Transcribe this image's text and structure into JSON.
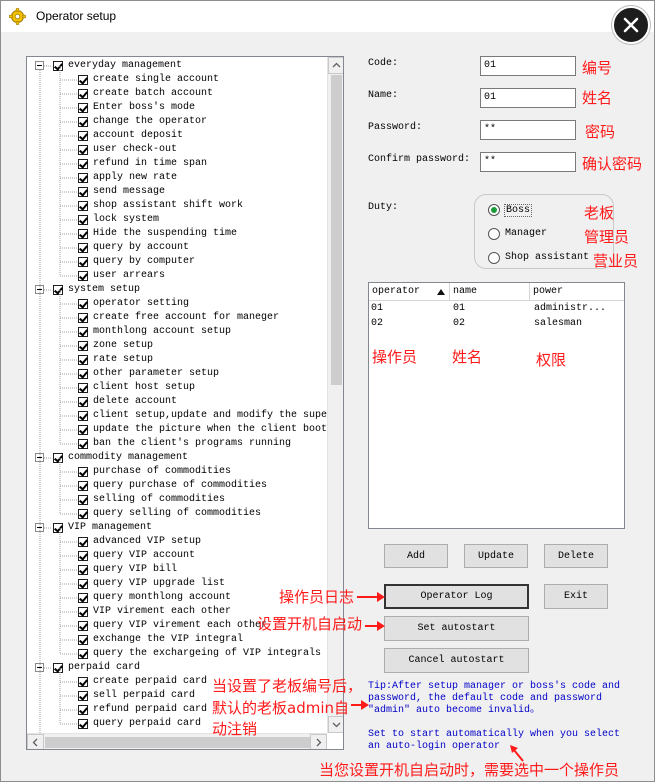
{
  "window": {
    "title": "Operator setup"
  },
  "tree": [
    {
      "label": "everyday management",
      "level": 0,
      "expander": true
    },
    {
      "label": "create single account",
      "level": 1
    },
    {
      "label": "create batch account",
      "level": 1
    },
    {
      "label": "Enter boss's mode",
      "level": 1
    },
    {
      "label": "change the operator",
      "level": 1
    },
    {
      "label": "account deposit",
      "level": 1
    },
    {
      "label": "user check-out",
      "level": 1
    },
    {
      "label": "refund in time span",
      "level": 1
    },
    {
      "label": "apply new rate",
      "level": 1
    },
    {
      "label": "send message",
      "level": 1
    },
    {
      "label": "shop assistant shift work",
      "level": 1
    },
    {
      "label": "lock system",
      "level": 1
    },
    {
      "label": "Hide the suspending time",
      "level": 1
    },
    {
      "label": " query by account",
      "level": 1
    },
    {
      "label": " query by computer",
      "level": 1
    },
    {
      "label": "user arrears",
      "level": 1
    },
    {
      "label": "system setup",
      "level": 0,
      "expander": true
    },
    {
      "label": "operator setting",
      "level": 1
    },
    {
      "label": "create free account for maneger",
      "level": 1
    },
    {
      "label": "monthlong account setup",
      "level": 1
    },
    {
      "label": "zone setup",
      "level": 1
    },
    {
      "label": "rate setup",
      "level": 1
    },
    {
      "label": "other parameter setup",
      "level": 1
    },
    {
      "label": "client host setup",
      "level": 1
    },
    {
      "label": "delete account",
      "level": 1
    },
    {
      "label": "client setup,update and modify the supe",
      "level": 1
    },
    {
      "label": "update the picture when the client boot",
      "level": 1
    },
    {
      "label": "ban the client's programs running",
      "level": 1
    },
    {
      "label": "commodity management",
      "level": 0,
      "expander": true
    },
    {
      "label": "purchase of commodities",
      "level": 1
    },
    {
      "label": "query purchase of commodities",
      "level": 1
    },
    {
      "label": "selling of commodities",
      "level": 1
    },
    {
      "label": "query selling of commodities",
      "level": 1
    },
    {
      "label": "VIP management",
      "level": 0,
      "expander": true
    },
    {
      "label": "advanced VIP setup",
      "level": 1
    },
    {
      "label": "query VIP account",
      "level": 1
    },
    {
      "label": "query VIP bill",
      "level": 1
    },
    {
      "label": "query VIP upgrade list",
      "level": 1
    },
    {
      "label": "query monthlong account",
      "level": 1
    },
    {
      "label": "VIP virement each other",
      "level": 1
    },
    {
      "label": "query VIP virement each other",
      "level": 1
    },
    {
      "label": "exchange the VIP integral",
      "level": 1
    },
    {
      "label": "query the exchargeing of VIP integrals",
      "level": 1
    },
    {
      "label": "perpaid card",
      "level": 0,
      "expander": true
    },
    {
      "label": "create perpaid card",
      "level": 1
    },
    {
      "label": "sell perpaid card",
      "level": 1
    },
    {
      "label": "refund perpaid card",
      "level": 1
    },
    {
      "label": "query perpaid card",
      "level": 1
    }
  ],
  "form": {
    "code_label": "Code:",
    "code_value": "01",
    "code_cn": "编号",
    "name_label": "Name:",
    "name_value": "01",
    "name_cn": "姓名",
    "password_label": "Password:",
    "password_value": "**",
    "password_cn": "密码",
    "confirm_label": "Confirm password:",
    "confirm_value": "**",
    "confirm_cn": "确认密码",
    "duty_label": "Duty:"
  },
  "duty": {
    "options": [
      "Boss",
      "Manager",
      "Shop assistant"
    ],
    "selected": "Boss",
    "cn": [
      "老板",
      "管理员",
      "营业员"
    ]
  },
  "grid": {
    "headers": [
      "operator",
      "name",
      "power"
    ],
    "rows": [
      [
        "01",
        "01",
        "administr..."
      ],
      [
        "02",
        "02",
        "salesman"
      ]
    ],
    "cn_headers": [
      "操作员",
      "姓名",
      "权限"
    ]
  },
  "buttons": {
    "add": "Add",
    "update": "Update",
    "delete": "Delete",
    "operator_log": "Operator Log",
    "exit": "Exit",
    "set_autostart": "Set autostart",
    "cancel_autostart": "Cancel autostart"
  },
  "annotations": {
    "operator_log_cn": "操作员日志",
    "autostart_cn": "设置开机自启动",
    "boss_note_cn_1": "当设置了老板编号后，",
    "boss_note_cn_2": "默认的老板admin自",
    "boss_note_cn_3": "动注销",
    "bottom_cn": "当您设置开机自启动时，需要选中一个操作员"
  },
  "tips": {
    "tip1": "Tip:After setup manager or boss's code and\npassword, the default code and password\n\"admin\" auto become invalid。",
    "tip2": "Set to start automatically when you select\nan auto-login operator"
  },
  "colors": {
    "annotation": "#ff1a1a",
    "tip": "#0000c8",
    "radio_selected": "#1a9c3a"
  }
}
